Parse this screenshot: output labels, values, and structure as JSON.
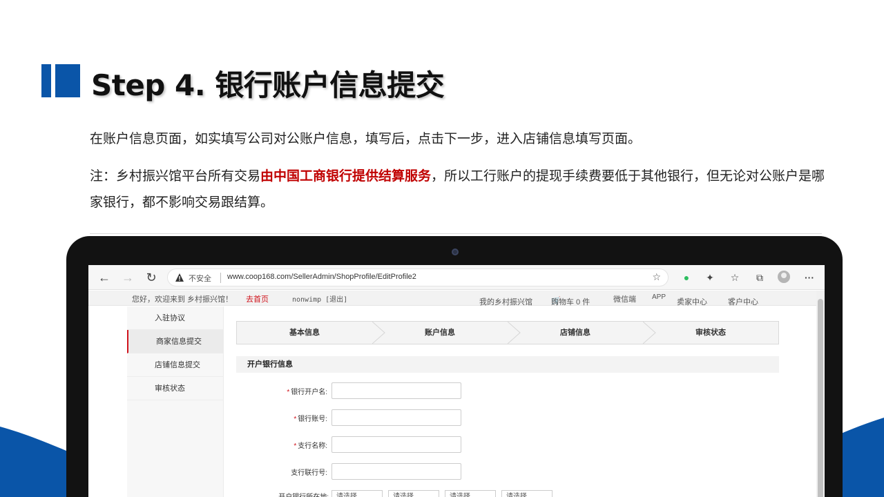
{
  "slide": {
    "title": "Step 4. 银行账户信息提交",
    "p1": "在账户信息页面，如实填写公司对公账户信息，填写后，点击下一步，进入店铺信息填写页面。",
    "p2_pre": "注：乡村振兴馆平台所有交易",
    "p2_highlight": "由中国工商银行提供结算服务",
    "p2_post": "，所以工行账户的提现手续费要低于其他银行，但无论对公账户是哪家银行，都不影响交易跟结算。",
    "colors": {
      "accent": "#0a55a8",
      "highlight": "#c00000",
      "site_red": "#d0121b"
    }
  },
  "browser": {
    "insecure_label": "不安全",
    "url": "www.coop168.com/SellerAdmin/ShopProfile/EditProfile2"
  },
  "site": {
    "topbar": {
      "hello": "您好，欢迎来到  乡村振兴馆！",
      "home": "去首页",
      "user": "nonwimp [退出]",
      "my_shop": "我的乡村振兴馆",
      "cart": "购物车 0 件",
      "wechat": "微信端",
      "app": "APP",
      "seller": "卖家中心",
      "customer": "客户中心"
    },
    "sidebar": [
      {
        "label": "入驻协议"
      },
      {
        "label": "商家信息提交"
      },
      {
        "label": "店铺信息提交"
      },
      {
        "label": "审核状态"
      }
    ],
    "steps": [
      {
        "label": "基本信息"
      },
      {
        "label": "账户信息"
      },
      {
        "label": "店铺信息"
      },
      {
        "label": "审核状态"
      }
    ],
    "section_title": "开户银行信息",
    "fields": [
      {
        "label": "银行开户名:",
        "required": true,
        "value": ""
      },
      {
        "label": "银行账号:",
        "required": true,
        "value": ""
      },
      {
        "label": "支行名称:",
        "required": true,
        "value": ""
      },
      {
        "label": "支行联行号:",
        "required": false,
        "value": ""
      }
    ],
    "region_label": "开户银行所在地:",
    "region_selects": [
      "请选择",
      "请选择",
      "请选择",
      "请选择"
    ]
  }
}
